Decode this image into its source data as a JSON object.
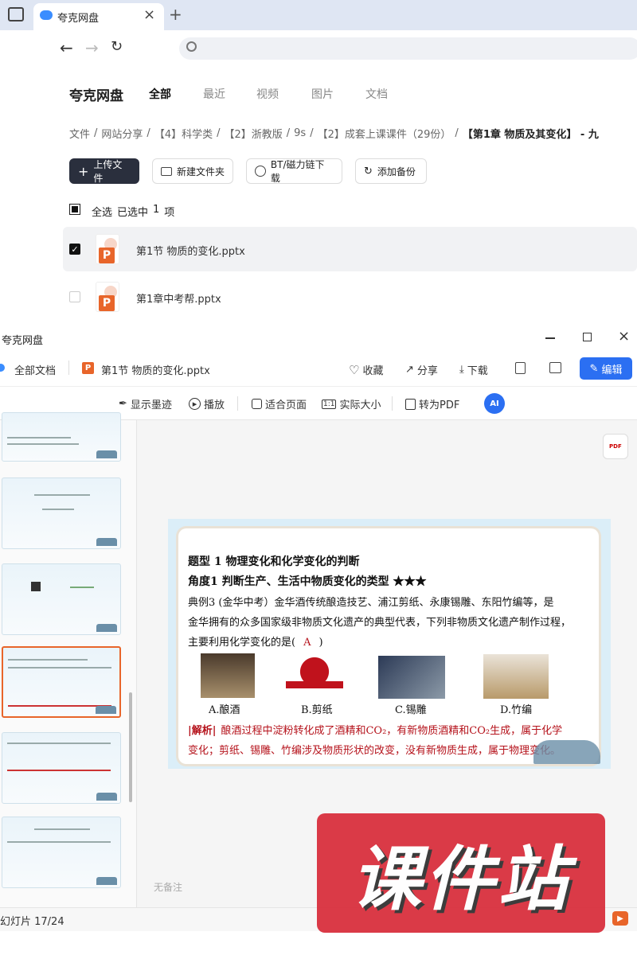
{
  "browser": {
    "tab_title": "夸克网盘"
  },
  "header": {
    "brand": "夸克网盘",
    "tabs": [
      "全部",
      "最近",
      "视频",
      "图片",
      "文档"
    ],
    "breadcrumb": [
      "文件",
      "网站分享",
      "【4】科学类",
      "【2】浙教版",
      "9s",
      "【2】成套上课课件（29份）",
      "【第1章 物质及其变化】 - 九"
    ],
    "buttons": {
      "upload": "上传文件",
      "new_folder": "新建文件夹",
      "bt": "BT/磁力链下载",
      "backup": "添加备份"
    },
    "select_all": "全选",
    "selected_prefix": "已选中",
    "selected_count": "1",
    "selected_unit": "项"
  },
  "files": [
    {
      "name": "第1节 物质的变化.pptx",
      "checked": true
    },
    {
      "name": "第1章中考帮.pptx",
      "checked": false
    }
  ],
  "viewer": {
    "window_title": "夸克网盘",
    "all_docs": "全部文档",
    "file_name": "第1节 物质的变化.pptx",
    "actions": {
      "fav": "收藏",
      "share": "分享",
      "download": "下载",
      "edit": "编辑"
    },
    "tools": {
      "ink": "显示墨迹",
      "play": "播放",
      "fit": "适合页面",
      "actual": "实际大小",
      "pdf": "转为PDF"
    },
    "pdf_badge": "PDF",
    "no_notes": "无备注",
    "status": "幻灯片 17/24"
  },
  "slide": {
    "title": "题型 1  物理变化和化学变化的判断",
    "subtitle": "角度1  判断生产、生活中物质变化的类型  ★★★",
    "line1": "典例3   (金华中考）金华酒传统酿造技艺、浦江剪纸、永康锡雕、东阳竹编等，是",
    "line2": "金华拥有的众多国家级非物质文化遗产的典型代表，下列非物质文化遗产制作过程，",
    "line3": "主要利用化学变化的是(",
    "answer": "A",
    "line3_end": ")",
    "options": [
      "A.酿酒",
      "B.剪纸",
      "C.锡雕",
      "D.竹编"
    ],
    "analysis_label": "|解析|",
    "analysis1": "酿酒过程中淀粉转化成了酒精和CO₂，有新物质酒精和CO₂生成，属于化学",
    "analysis2": "变化；剪纸、锡雕、竹编涉及物质形状的改变，没有新物质生成，属于物理变化。"
  },
  "watermark": "课件站",
  "colors": {
    "accent": "#2b6ff2",
    "dark_button": "#2a2f3d",
    "red": "#b5121b",
    "watermark": "#d9303e"
  }
}
